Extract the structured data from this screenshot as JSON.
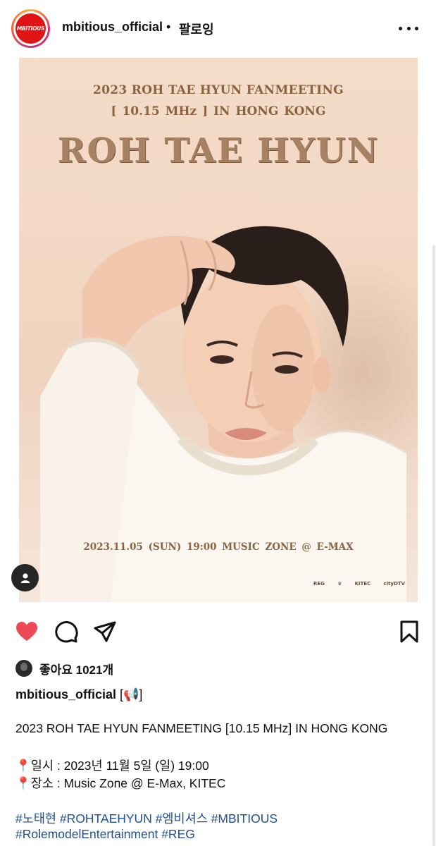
{
  "header": {
    "avatar_logo": "MBITIOUS",
    "username": "mbitious_official",
    "separator": "•",
    "follow_label": "팔로잉",
    "more_icon": "more-horizontal-icon"
  },
  "poster": {
    "title_line1": "2023 ROH TAE HYUN FANMEETING",
    "title_line2": "[ 10.15 MHz ]   IN HONG KONG",
    "name": "ROH TAE HYUN",
    "event_info": "2023.11.05 (SUN) 19:00     MUSIC ZONE @ E-MAX",
    "sponsors": [
      "REG",
      "♛",
      "KITEC",
      "cityDTV"
    ]
  },
  "actions": {
    "like_icon": "heart-filled-icon",
    "comment_icon": "comment-icon",
    "share_icon": "send-icon",
    "save_icon": "bookmark-icon",
    "like_color": "#ed4956"
  },
  "likes": {
    "text": "좋아요 1021개"
  },
  "caption": {
    "username": "mbitious_official",
    "header_text": "[📢]",
    "line1": "2023 ROH TAE HYUN FANMEETING [10.15 MHz] IN HONG KONG",
    "date_pin": "📍",
    "date_text": "일시 : 2023년 11월 5일 (일) 19:00",
    "place_pin": "📍",
    "place_text": "장소 : Music Zone @ E-Max, KITEC",
    "hashtags_line1": "#노태현 #ROHTAEHYUN #엠비셔스 #MBITIOUS",
    "hashtags_line2": "#RolemodelEntertainment #REG"
  },
  "colors": {
    "brand_red": "#e01414",
    "hashtag_blue": "#1f4f8f",
    "poster_gold": "#8a6440"
  }
}
